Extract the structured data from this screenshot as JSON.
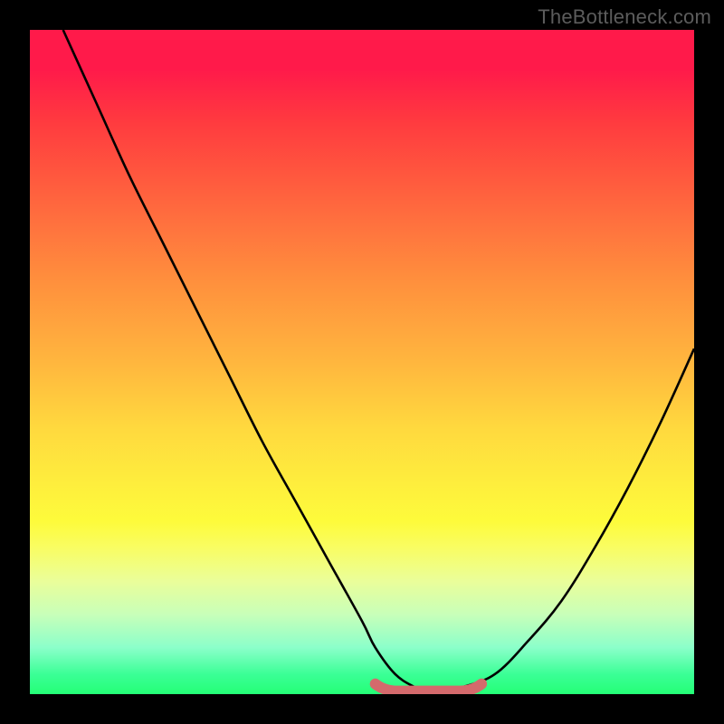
{
  "watermark": "TheBottleneck.com",
  "colors": {
    "frame_bg": "#000000",
    "curve_stroke": "#000000",
    "tolerance_stroke": "#d46a6c",
    "gradient_top": "#ff1a4a",
    "gradient_bottom": "#24ff76"
  },
  "chart_data": {
    "type": "line",
    "title": "",
    "xlabel": "",
    "ylabel": "",
    "xlim": [
      0,
      100
    ],
    "ylim": [
      0,
      100
    ],
    "grid": false,
    "series": [
      {
        "name": "bottleneck-curve",
        "x": [
          5,
          10,
          15,
          20,
          25,
          30,
          35,
          40,
          45,
          50,
          52,
          55,
          58,
          60,
          62,
          65,
          70,
          75,
          80,
          85,
          90,
          95,
          100
        ],
        "y": [
          100,
          89,
          78,
          68,
          58,
          48,
          38,
          29,
          20,
          11,
          7,
          3,
          1,
          0,
          0,
          1,
          3,
          8,
          14,
          22,
          31,
          41,
          52
        ]
      }
    ],
    "annotations": [
      {
        "name": "tolerance-band",
        "x_range": [
          52,
          68
        ],
        "y": 1
      }
    ],
    "background": "red-yellow-green vertical gradient"
  }
}
